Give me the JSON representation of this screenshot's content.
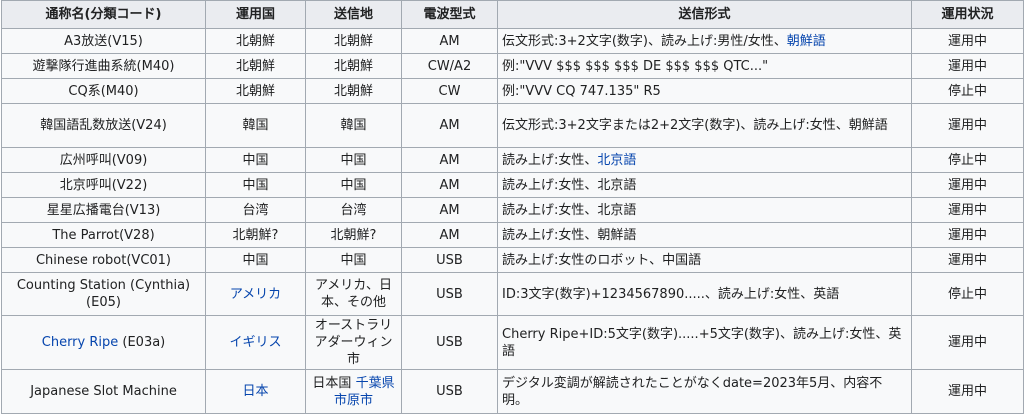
{
  "headers": [
    "通称名(分類コード)",
    "運用国",
    "送信地",
    "電波型式",
    "送信形式",
    "運用状況"
  ],
  "rows": [
    {
      "name": [
        {
          "t": "A3放送(V15)"
        }
      ],
      "country": [
        {
          "t": "北朝鮮"
        }
      ],
      "location": [
        {
          "t": "北朝鮮"
        }
      ],
      "mode": "AM",
      "format": [
        {
          "t": "伝文形式:3+2文字(数字)、読み上げ:男性/女性、"
        },
        {
          "t": "朝鮮語",
          "link": true
        }
      ],
      "status": "運用中"
    },
    {
      "name": [
        {
          "t": "遊撃隊行進曲系統(M40)"
        }
      ],
      "country": [
        {
          "t": "北朝鮮"
        }
      ],
      "location": [
        {
          "t": "北朝鮮"
        }
      ],
      "mode": "CW/A2",
      "format": [
        {
          "t": "例:\"VVV $$$ $$$ $$$ DE $$$ $$$ QTC...\""
        }
      ],
      "status": "運用中"
    },
    {
      "name": [
        {
          "t": "CQ系(M40)"
        }
      ],
      "country": [
        {
          "t": "北朝鮮"
        }
      ],
      "location": [
        {
          "t": "北朝鮮"
        }
      ],
      "mode": "CW",
      "format": [
        {
          "t": "例:\"VVV CQ 747.135\" R5"
        }
      ],
      "status": "停止中"
    },
    {
      "name": [
        {
          "t": "韓国語乱数放送(V24)"
        }
      ],
      "country": [
        {
          "t": "韓国"
        }
      ],
      "location": [
        {
          "t": "韓国"
        }
      ],
      "mode": "AM",
      "format": [
        {
          "t": "伝文形式:3+2文字または2+2文字(数字)、読み上げ:女性、朝鮮語"
        }
      ],
      "status": "運用中"
    },
    {
      "name": [
        {
          "t": "広州呼叫(V09)"
        }
      ],
      "country": [
        {
          "t": "中国"
        }
      ],
      "location": [
        {
          "t": "中国"
        }
      ],
      "mode": "AM",
      "format": [
        {
          "t": "読み上げ:女性、"
        },
        {
          "t": "北京語",
          "link": true
        }
      ],
      "status": "停止中"
    },
    {
      "name": [
        {
          "t": "北京呼叫(V22)"
        }
      ],
      "country": [
        {
          "t": "中国"
        }
      ],
      "location": [
        {
          "t": "中国"
        }
      ],
      "mode": "AM",
      "format": [
        {
          "t": "読み上げ:女性、北京語"
        }
      ],
      "status": "運用中"
    },
    {
      "name": [
        {
          "t": "星星広播電台(V13)"
        }
      ],
      "country": [
        {
          "t": "台湾"
        }
      ],
      "location": [
        {
          "t": "台湾"
        }
      ],
      "mode": "AM",
      "format": [
        {
          "t": "読み上げ:女性、北京語"
        }
      ],
      "status": "運用中"
    },
    {
      "name": [
        {
          "t": "The Parrot(V28)"
        }
      ],
      "country": [
        {
          "t": "北朝鮮?"
        }
      ],
      "location": [
        {
          "t": "北朝鮮?"
        }
      ],
      "mode": "AM",
      "format": [
        {
          "t": "読み上げ:女性、朝鮮語"
        }
      ],
      "status": "運用中"
    },
    {
      "name": [
        {
          "t": "Chinese robot(VC01)"
        }
      ],
      "country": [
        {
          "t": "中国"
        }
      ],
      "location": [
        {
          "t": "中国"
        }
      ],
      "mode": "USB",
      "format": [
        {
          "t": "読み上げ:女性のロボット、中国語"
        }
      ],
      "status": "運用中"
    },
    {
      "name": [
        {
          "t": "Counting Station (Cynthia) (E05)"
        }
      ],
      "country": [
        {
          "t": "アメリカ",
          "link": true
        }
      ],
      "location": [
        {
          "t": "アメリカ、日本、その他"
        }
      ],
      "mode": "USB",
      "format": [
        {
          "t": "ID:3文字(数字)+1234567890.....、読み上げ:女性、英語"
        }
      ],
      "status": "停止中"
    },
    {
      "name": [
        {
          "t": "Cherry Ripe",
          "link": true
        },
        {
          "t": " (E03a)"
        }
      ],
      "country": [
        {
          "t": "イギリス",
          "link": true
        }
      ],
      "location": [
        {
          "t": "オーストラリアダーウィン市"
        }
      ],
      "mode": "USB",
      "format": [
        {
          "t": "Cherry Ripe+ID:5文字(数字).....+5文字(数字)、読み上げ:女性、英語"
        }
      ],
      "status": "運用中"
    },
    {
      "name": [
        {
          "t": "Japanese Slot Machine"
        }
      ],
      "country": [
        {
          "t": "日本",
          "link": true
        }
      ],
      "location": [
        {
          "t": "日本国 "
        },
        {
          "t": "千葉県",
          "link": true
        },
        {
          "t": " "
        },
        {
          "t": "市原市",
          "link": true
        }
      ],
      "mode": "USB",
      "format": [
        {
          "t": "デジタル変調が解読されたことがなくdate=2023年5月、内容不明。"
        }
      ],
      "status": "運用中"
    }
  ]
}
